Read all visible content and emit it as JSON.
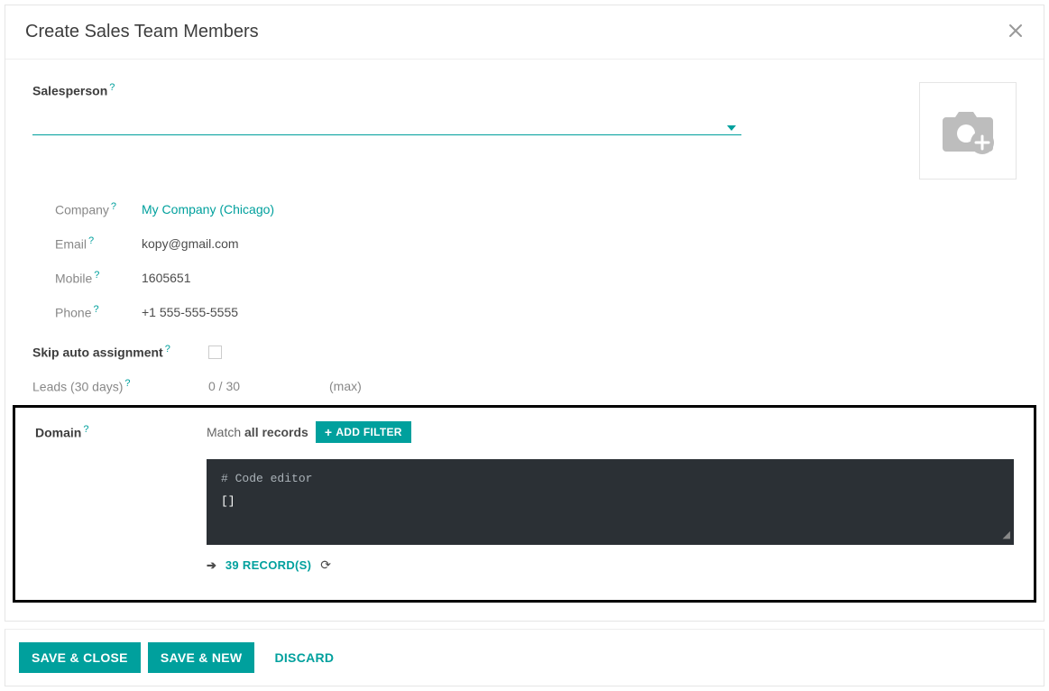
{
  "dialog": {
    "title": "Create Sales Team Members"
  },
  "form": {
    "salesperson_label": "Salesperson",
    "company_label": "Company",
    "company_value": "My Company (Chicago)",
    "email_label": "Email",
    "email_value": "kopy@gmail.com",
    "mobile_label": "Mobile",
    "mobile_value": "1605651",
    "phone_label": "Phone",
    "phone_value": "+1 555-555-5555",
    "skip_label": "Skip auto assignment",
    "leads_label": "Leads (30 days)",
    "leads_value": "0 / 30",
    "leads_max": "(max)"
  },
  "domain": {
    "label": "Domain",
    "match_prefix": "Match ",
    "match_strong": "all records",
    "add_filter": "ADD FILTER",
    "code_comment": "# Code editor",
    "code_body": "[]",
    "records": "39 RECORD(S)"
  },
  "footer": {
    "save_close": "SAVE & CLOSE",
    "save_new": "SAVE & NEW",
    "discard": "DISCARD"
  },
  "help_glyph": "?"
}
